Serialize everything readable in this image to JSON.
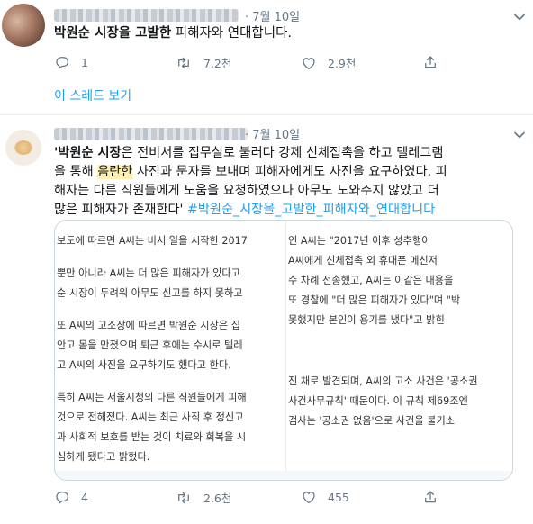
{
  "tweet1": {
    "date": "· 7월 10일",
    "text_bold": "박원순 시장을 고발한",
    "text_rest": " 피해자와 연대합니다.",
    "replies": "1",
    "retweets": "7.2천",
    "likes": "2.9천",
    "thread_link": "이 스레드 보기"
  },
  "tweet2": {
    "date": "· 7월 10일",
    "line1_bold": "'박원순 시장",
    "line1_rest": "은 전비서를 집무실로 불러다 강제 신체접촉을 하고 텔레그램",
    "line2_a": "을 통해 ",
    "line2_hl": "음란한",
    "line2_b": " 사진과 문자를 보내며 피해자에게도 사진을 요구하였다. 피",
    "line3": "해자는 다른 직원들에게 도움을 요청하였으나 아무도 도와주지 않았고 더",
    "line4_text": "많은 피해자가 존재한다' ",
    "line4_hashtag": "#박원순_시장을_고발한_피해자와_연대합니다",
    "replies": "4",
    "retweets": "2.6천",
    "likes": "455"
  },
  "card_left": [
    "보도에 따르면 A씨는 비서 일을 시작한 2017",
    "뿐만 아니라 A씨는 더 많은 피해자가 있다고",
    "순 시장이 두려워 아무도 신고를 하지 못하고",
    "또 A씨의 고소장에 따르면 박원순 시장은 집",
    "안고 몸을 만졌으며 퇴근 후에는 수시로 텔레",
    "고 A씨의 사진을 요구하기도 했다고 한다.",
    "특히 A씨는 서울시청의 다른 직원들에게 피해",
    "것으로 전해졌다. A씨는 최근 사직 후 정신고",
    "과 사회적 보호를 받는 것이 치료와 회복을 시",
    "심하게 됐다고 밝혔다."
  ],
  "card_right": [
    "인 A씨는 \"2017년 이후 성추행이",
    "A씨에게 신체접촉 외 휴대폰 메신저",
    "수 차례 전송했고, A씨는 이같은 내용을",
    "또 경찰에 \"더 많은 피해자가 있다\"며 \"박",
    "못했지만 본인이 용기를 냈다\"고 밝힌",
    "진 채로 발견되며, A씨의 고소 사건은 '공소권",
    "사건사무규칙' 때문이다. 이 규칙 제69조엔",
    "검사는 '공소권 없음'으로 사건을 불기소"
  ]
}
